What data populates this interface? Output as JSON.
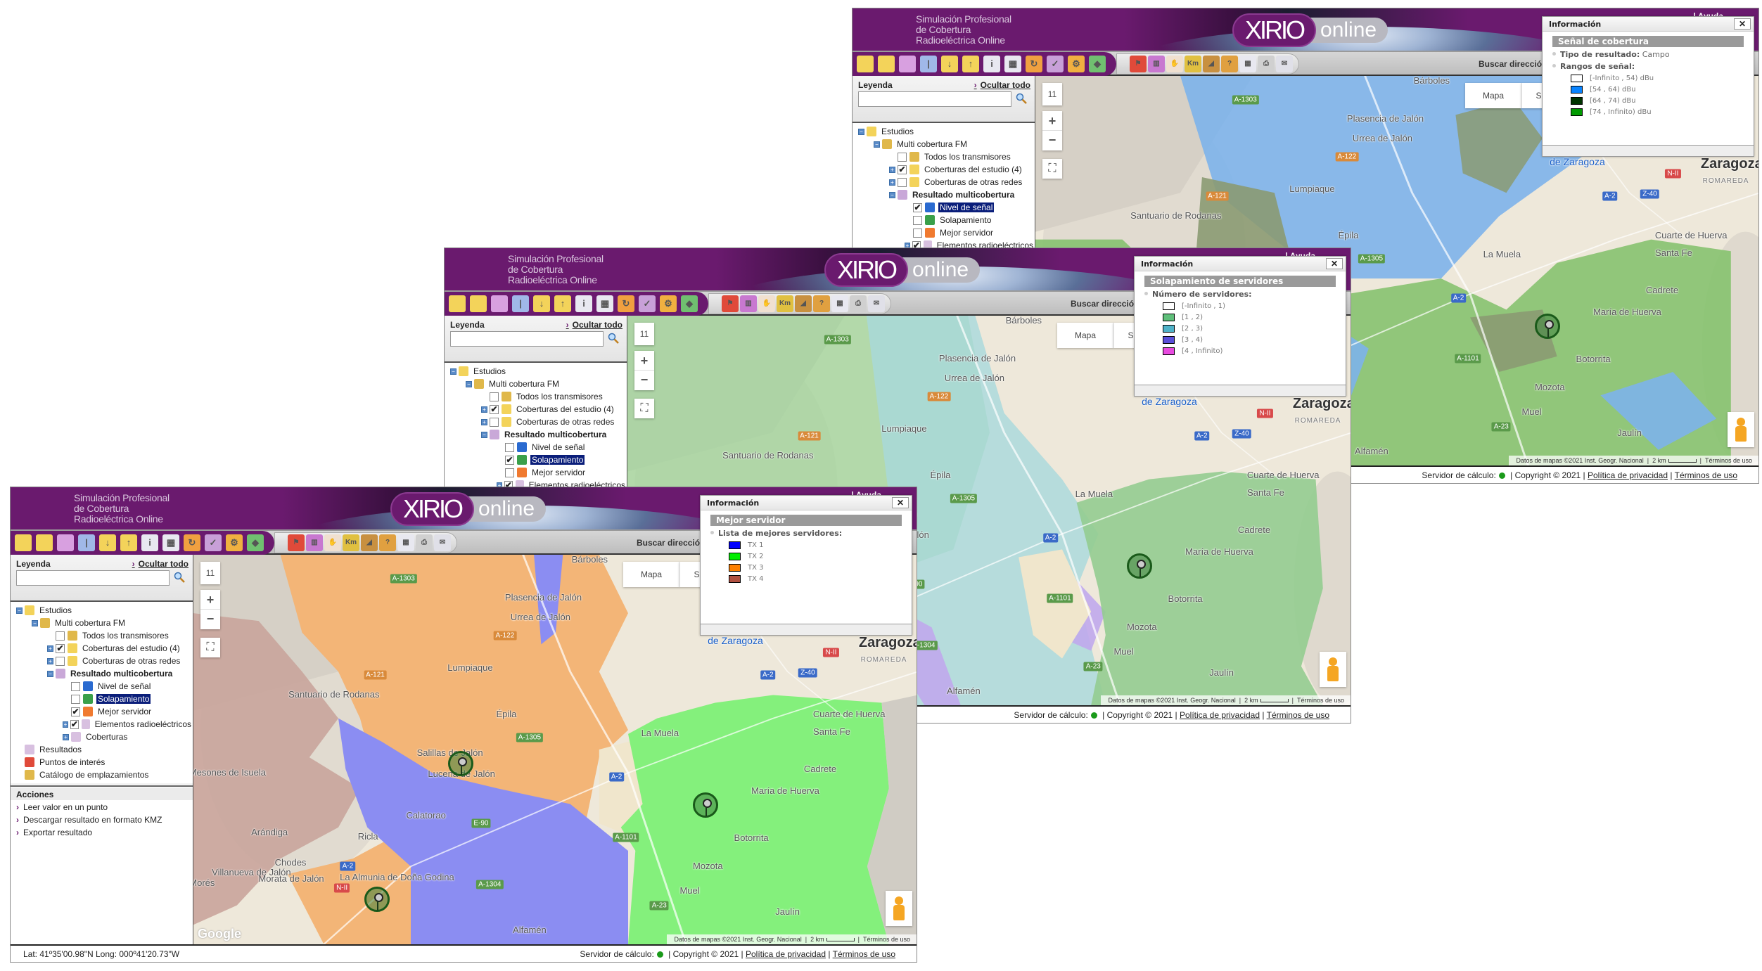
{
  "app": {
    "tagline": [
      "Simulación Profesional",
      "de Cobertura",
      "Radioeléctrica Online"
    ],
    "logo_main": "XIRIO",
    "logo_sub": "online",
    "help": "|  Ayuda",
    "search_address": "Buscar dirección",
    "toolbar_icons_primary": [
      "new-study-icon",
      "open-folder-icon",
      "folder-icon",
      "library-icon",
      "import-icon",
      "export-icon",
      "info-table-icon",
      "table-icon",
      "refresh-icon",
      "user-check-icon",
      "user-settings-icon",
      "user-map-icon"
    ],
    "toolbar_icons_secondary": [
      "points-of-interest-flag-icon",
      "layers-icon",
      "hand-pan-icon",
      "measure-distance-km-icon",
      "profile-icon",
      "elevation-query-icon",
      "color-legend-icon",
      "print-icon",
      "email-icon"
    ]
  },
  "legend": {
    "title": "Leyenda",
    "hide_all": "Ocultar todo",
    "search_value": ""
  },
  "tree": [
    {
      "label": "Estudios",
      "level": 0,
      "expander": "-",
      "checkbox": false,
      "icon_color": "#f3d35a"
    },
    {
      "label": "Multi cobertura FM",
      "level": 1,
      "expander": "-",
      "checkbox": false,
      "icon_color": "#e0b84a"
    },
    {
      "label": "Todos los transmisores",
      "level": 2,
      "expander": "",
      "checkbox": true,
      "icon_color": "#e0b84a"
    },
    {
      "label": "Coberturas del estudio (4)",
      "level": 2,
      "expander": "+",
      "checkbox": true,
      "icon_color": "#f3d35a"
    },
    {
      "label": "Coberturas de otras redes",
      "level": 2,
      "expander": "+",
      "checkbox": true,
      "icon_color": "#f3d35a"
    },
    {
      "label": "Resultado multicobertura",
      "level": 2,
      "expander": "-",
      "checkbox": false,
      "bold": true,
      "icon_color": "#c9a8d8"
    },
    {
      "label": "Nivel de señal",
      "level": 3,
      "expander": "",
      "checkbox": true,
      "icon_color": "#2a6ad0"
    },
    {
      "label": "Solapamiento",
      "level": 3,
      "expander": "",
      "checkbox": true,
      "icon_color": "#3aa04a"
    },
    {
      "label": "Mejor servidor",
      "level": 3,
      "expander": "",
      "checkbox": true,
      "icon_color": "#f07a30"
    },
    {
      "label": "Elementos radioeléctricos",
      "level": 3,
      "expander": "+",
      "checkbox": true,
      "icon_color": "#d8c0e0"
    },
    {
      "label": "Coberturas",
      "level": 3,
      "expander": "+",
      "checkbox": false,
      "icon_color": "#d8c0e0"
    },
    {
      "label": "Resultados",
      "level": 0,
      "expander": "",
      "checkbox": false,
      "icon_color": "#d8c0e0"
    },
    {
      "label": "Puntos de interés",
      "level": 0,
      "expander": "",
      "checkbox": false,
      "icon_color": "#e04a3a"
    },
    {
      "label": "Catálogo de emplazamientos",
      "level": 0,
      "expander": "",
      "checkbox": false,
      "icon_color": "#e0b84a"
    }
  ],
  "actions": {
    "title": "Acciones",
    "items": [
      "Leer valor en un punto",
      "Descargar resultado en formato KMZ",
      "Exportar resultado"
    ]
  },
  "map": {
    "zoom_level": "11",
    "map_type": [
      "Mapa",
      "Satélite"
    ],
    "attribution": "Datos de mapas ©2021 Inst. Geogr. Nacional",
    "scale": "2 km",
    "terms": "Términos de uso",
    "google": "Google",
    "places": [
      "Bárboles",
      "Plasencia de Jalón",
      "Urrea de Jalón",
      "Lumpiaque",
      "Santuario de Rodanas",
      "Épila",
      "La Muela",
      "de Zaragoza",
      "Zaragoza",
      "ROMAREDA",
      "Cuarte de Huerva",
      "Santa Fe",
      "Cadrete",
      "María de Huerva",
      "Botorrita",
      "Mozota",
      "Muel",
      "Jaulín",
      "Alfamén",
      "Salillas de Jalón",
      "Lucena de Jalón",
      "Mesones de Isuela",
      "Calatorao",
      "Ricla",
      "Arándiga",
      "Chodes",
      "Villanueva de Jalón",
      "Morata de Jalón",
      "Morés",
      "La Almunia de Doña Godina"
    ],
    "roads": [
      "A-1303",
      "A-122",
      "A-121",
      "A-1305",
      "A-2",
      "A-1101",
      "A-23",
      "N-II",
      "A-2",
      "Z-40",
      "A-1304",
      "E-90",
      "A-2",
      "N-II"
    ]
  },
  "footer": {
    "server_label": "Servidor de cálculo:",
    "server_status_color": "#1a9a1a",
    "copyright": "Copyright © 2021",
    "privacy": "Política de privacidad",
    "terms": "Términos de uso"
  },
  "windows": [
    {
      "coverage": "signal",
      "tree_checked": [
        false,
        false,
        false,
        true,
        false,
        false,
        true,
        false,
        false,
        true,
        false,
        false,
        false,
        false
      ],
      "tree_selected": 6,
      "latlong": "",
      "info": {
        "title": "Información",
        "heading": "Señal de cobertura",
        "rows": [
          {
            "label": "Tipo de resultado:",
            "value": "Campo"
          },
          {
            "label": "Rangos de señal:",
            "value": ""
          }
        ],
        "legend": [
          {
            "color": "#ffffff",
            "label": "[-Infinito , 54) dBu"
          },
          {
            "color": "#0a84ff",
            "label": "[54 , 64) dBu"
          },
          {
            "color": "#003300",
            "label": "[64 , 74) dBu"
          },
          {
            "color": "#009a00",
            "label": "[74 , Infinito) dBu"
          }
        ]
      }
    },
    {
      "coverage": "overlap",
      "tree_checked": [
        false,
        false,
        false,
        true,
        false,
        false,
        false,
        true,
        false,
        true,
        false,
        false,
        false,
        false
      ],
      "tree_selected": 7,
      "latlong": "",
      "info": {
        "title": "Información",
        "heading": "Solapamiento de servidores",
        "rows": [
          {
            "label": "Número de servidores:",
            "value": ""
          }
        ],
        "legend": [
          {
            "color": "#ffffff",
            "label": "[-Infinito , 1)"
          },
          {
            "color": "#5fbf7a",
            "label": "[1 , 2)"
          },
          {
            "color": "#4fb2c8",
            "label": "[2 , 3)"
          },
          {
            "color": "#5a4fd8",
            "label": "[3 , 4)"
          },
          {
            "color": "#e84ae0",
            "label": "[4 , Infinito)"
          }
        ]
      }
    },
    {
      "coverage": "best",
      "tree_checked": [
        false,
        false,
        false,
        true,
        false,
        false,
        false,
        false,
        true,
        true,
        false,
        false,
        false,
        false
      ],
      "tree_selected": 7,
      "latlong": "Lat: 41º35'00.98\"N Long: 000º41'20.73\"W",
      "info": {
        "title": "Información",
        "heading": "Mejor servidor",
        "rows": [
          {
            "label": "Lista de mejores servidores:",
            "value": ""
          }
        ],
        "legend": [
          {
            "color": "#0000ff",
            "label": "TX 1"
          },
          {
            "color": "#00ee00",
            "label": "TX 2"
          },
          {
            "color": "#ff8000",
            "label": "TX 3"
          },
          {
            "color": "#b05040",
            "label": "TX 4"
          }
        ]
      }
    }
  ]
}
